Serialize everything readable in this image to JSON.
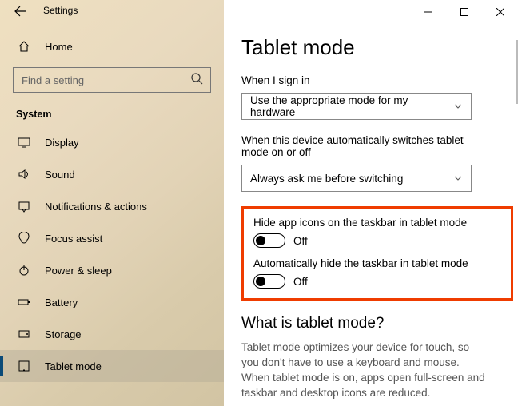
{
  "app_title": "Settings",
  "home_label": "Home",
  "search_placeholder": "Find a setting",
  "section_title": "System",
  "nav": [
    {
      "label": "Display"
    },
    {
      "label": "Sound"
    },
    {
      "label": "Notifications & actions"
    },
    {
      "label": "Focus assist"
    },
    {
      "label": "Power & sleep"
    },
    {
      "label": "Battery"
    },
    {
      "label": "Storage"
    },
    {
      "label": "Tablet mode"
    }
  ],
  "page_title": "Tablet mode",
  "signin_label": "When I sign in",
  "signin_value": "Use the appropriate mode for my hardware",
  "switch_label": "When this device automatically switches tablet mode on or off",
  "switch_value": "Always ask me before switching",
  "toggle1_label": "Hide app icons on the taskbar in tablet mode",
  "toggle1_state": "Off",
  "toggle2_label": "Automatically hide the taskbar in tablet mode",
  "toggle2_state": "Off",
  "subhead": "What is tablet mode?",
  "description": "Tablet mode optimizes your device for touch, so you don't have to use a keyboard and mouse. When tablet mode is on, apps open full-screen and taskbar and desktop icons are reduced."
}
